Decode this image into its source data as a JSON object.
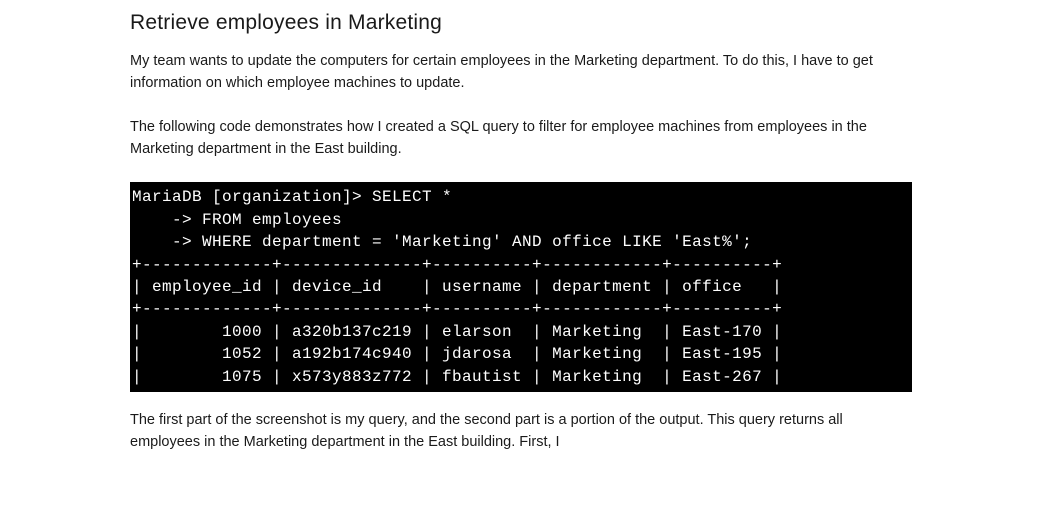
{
  "heading": "Retrieve employees in Marketing",
  "intro_paragraph": "My team wants to update the computers for certain employees in the Marketing department. To do this, I have to get information on which employee machines to update.",
  "second_paragraph": "The following code demonstrates how I created a SQL query to filter for employee machines from employees in the Marketing department in the East building.",
  "terminal": {
    "prompt": "MariaDB [organization]> ",
    "query_lines": [
      "SELECT *",
      "    -> FROM employees",
      "    -> WHERE department = 'Marketing' AND office LIKE 'East%';"
    ],
    "table_border": "+-------------+--------------+----------+------------+----------+",
    "columns": [
      "employee_id",
      "device_id",
      "username",
      "department",
      "office"
    ],
    "header_row": "| employee_id | device_id    | username | department | office   |",
    "rows": [
      {
        "employee_id": 1000,
        "device_id": "a320b137c219",
        "username": "elarson",
        "department": "Marketing",
        "office": "East-170"
      },
      {
        "employee_id": 1052,
        "device_id": "a192b174c940",
        "username": "jdarosa",
        "department": "Marketing",
        "office": "East-195"
      },
      {
        "employee_id": 1075,
        "device_id": "x573y883z772",
        "username": "fbautist",
        "department": "Marketing",
        "office": "East-267"
      }
    ],
    "row_lines": [
      "|        1000 | a320b137c219 | elarson  | Marketing  | East-170 |",
      "|        1052 | a192b174c940 | jdarosa  | Marketing  | East-195 |",
      "|        1075 | x573y883z772 | fbautist | Marketing  | East-267 |"
    ]
  },
  "closing_paragraph": "The first part of the screenshot is my query, and the second part is a portion of the output. This query returns all employees in the Marketing department in the East building. First, I"
}
